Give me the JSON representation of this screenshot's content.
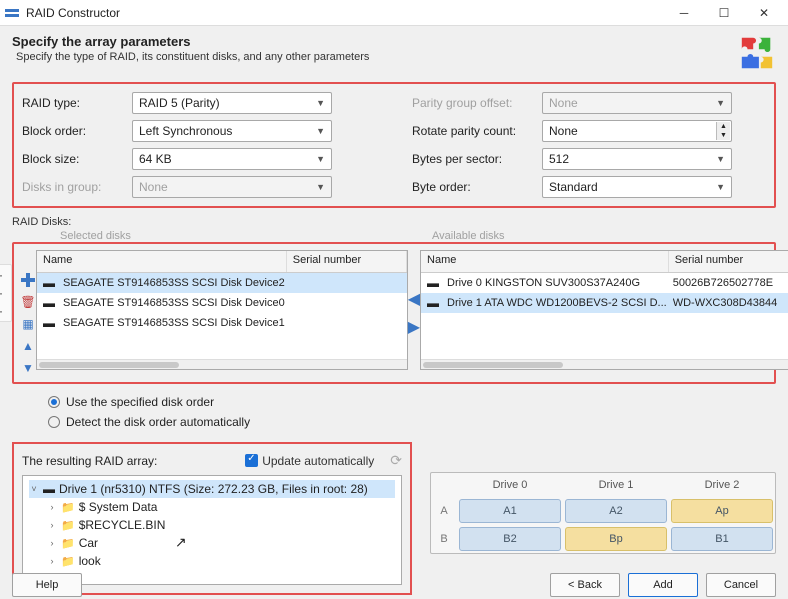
{
  "window": {
    "title": "RAID Constructor"
  },
  "header": {
    "title": "Specify the array parameters",
    "subtitle": "Specify the type of RAID, its constituent disks, and any other parameters"
  },
  "params": {
    "raid_type_lbl": "RAID type:",
    "raid_type": "RAID 5 (Parity)",
    "block_order_lbl": "Block order:",
    "block_order": "Left Synchronous",
    "block_size_lbl": "Block size:",
    "block_size": "64 KB",
    "disks_group_lbl": "Disks in group:",
    "disks_group": "None",
    "parity_offset_lbl": "Parity group offset:",
    "parity_offset": "None",
    "rotate_parity_lbl": "Rotate parity count:",
    "rotate_parity": "None",
    "bytes_sector_lbl": "Bytes per sector:",
    "bytes_sector": "512",
    "byte_order_lbl": "Byte order:",
    "byte_order": "Standard"
  },
  "disks_section": {
    "label": "RAID Disks:",
    "selected_lbl": "Selected disks",
    "available_lbl": "Available disks",
    "col_name": "Name",
    "col_serial": "Serial number",
    "selected": [
      {
        "name": "SEAGATE ST9146853SS SCSI Disk Device2",
        "serial": ""
      },
      {
        "name": "SEAGATE ST9146853SS SCSI Disk Device0",
        "serial": ""
      },
      {
        "name": "SEAGATE ST9146853SS SCSI Disk Device1",
        "serial": ""
      }
    ],
    "available": [
      {
        "name": "Drive 0 KINGSTON SUV300S37A240G",
        "serial": "50026B726502778E"
      },
      {
        "name": "Drive 1 ATA WDC WD1200BEVS-2 SCSI D...",
        "serial": "WD-WXC308D43844"
      }
    ]
  },
  "radios": {
    "specified": "Use the specified disk order",
    "auto": "Detect the disk order automatically"
  },
  "tree": {
    "label": "The resulting RAID array:",
    "update_lbl": "Update automatically",
    "root": "Drive 1 (nr5310) NTFS (Size: 272.23 GB, Files in root: 28)",
    "items": [
      "$ System Data",
      "$RECYCLE.BIN",
      "Car",
      "look"
    ]
  },
  "layout": {
    "headers": [
      "Drive 0",
      "Drive 1",
      "Drive 2"
    ],
    "rows": [
      {
        "label": "A",
        "cells": [
          {
            "t": "A1",
            "p": false
          },
          {
            "t": "A2",
            "p": false
          },
          {
            "t": "Ap",
            "p": true
          }
        ]
      },
      {
        "label": "B",
        "cells": [
          {
            "t": "B2",
            "p": false
          },
          {
            "t": "Bp",
            "p": true
          },
          {
            "t": "B1",
            "p": false
          }
        ]
      }
    ]
  },
  "footer": {
    "help": "Help",
    "back": "< Back",
    "add": "Add",
    "cancel": "Cancel"
  }
}
